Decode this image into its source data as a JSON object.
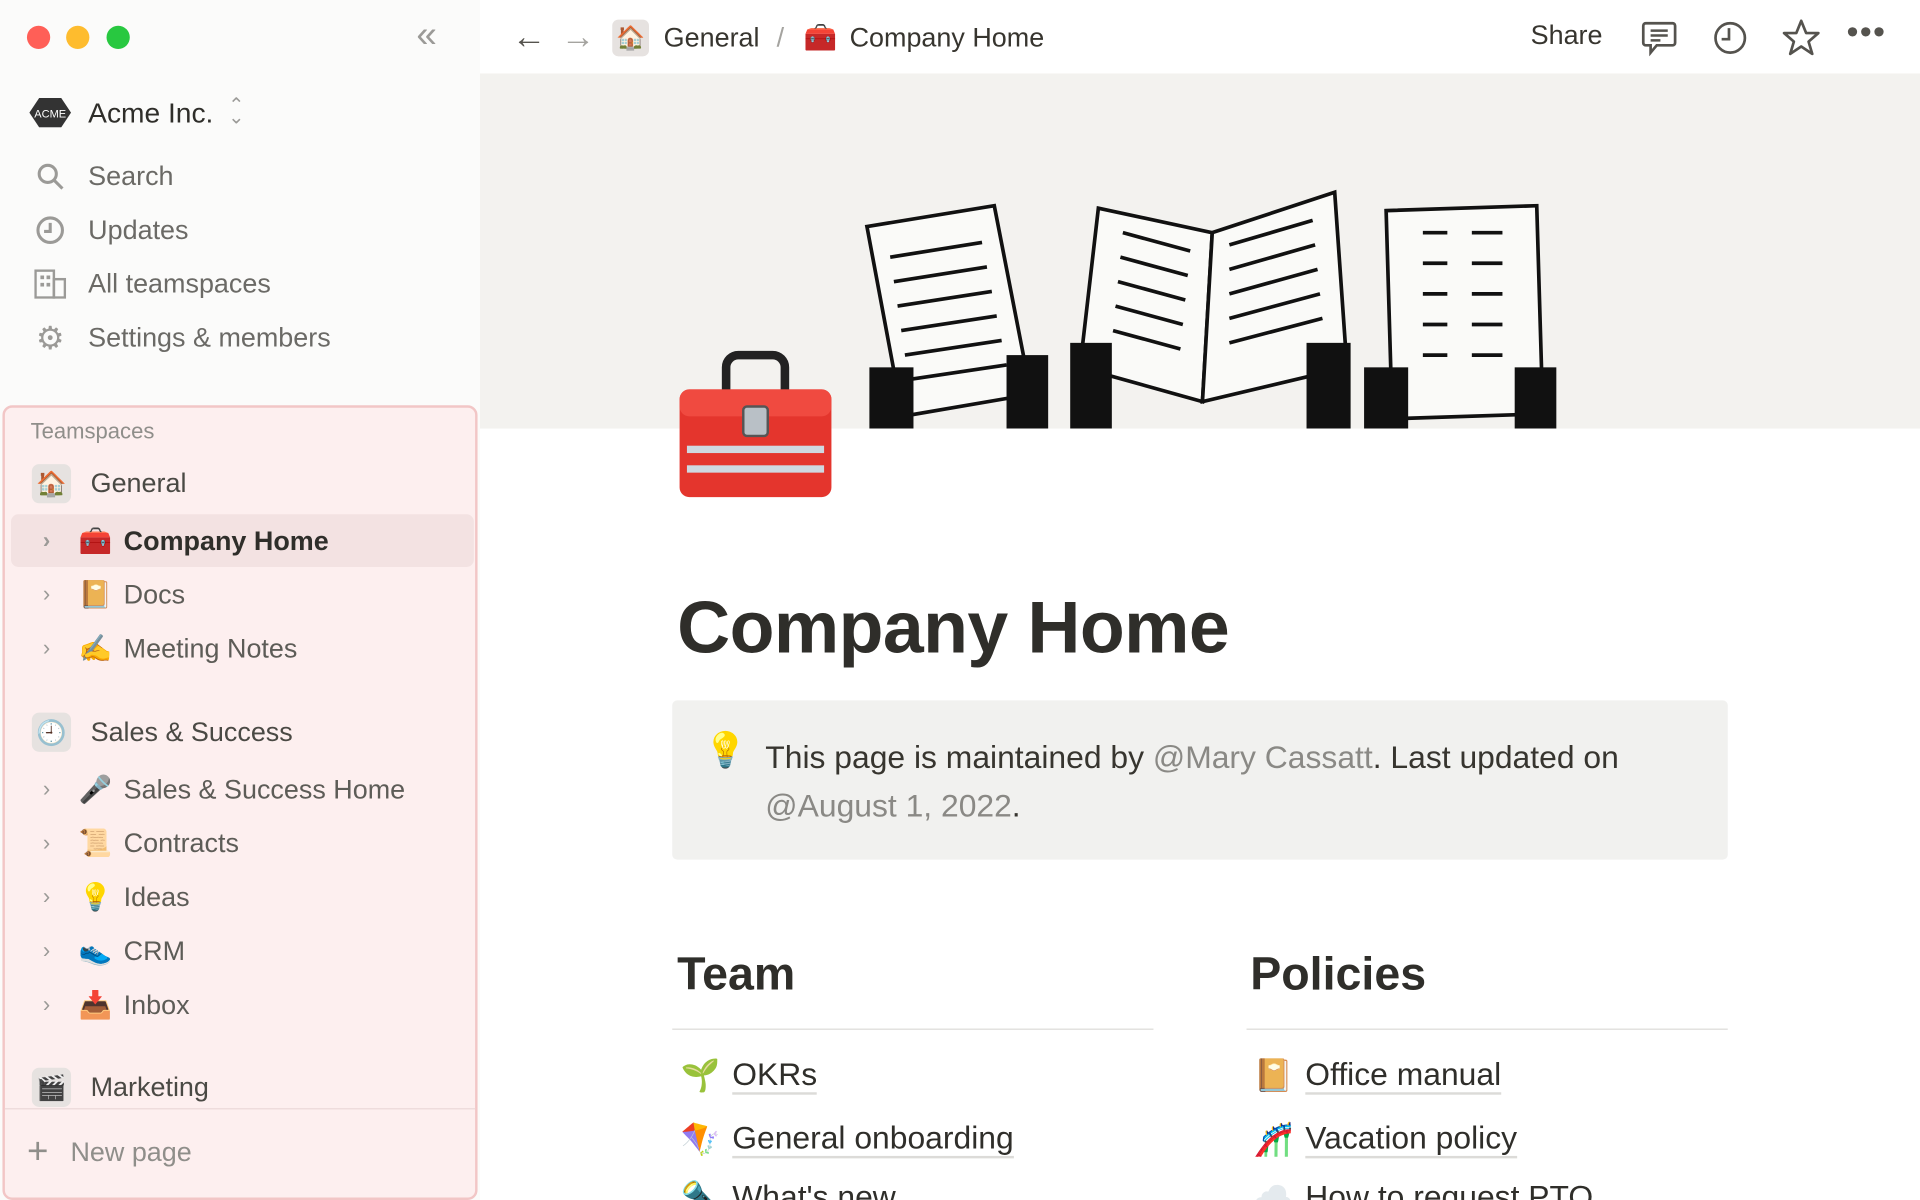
{
  "sidebar": {
    "workspace": {
      "name": "Acme Inc.",
      "logo_text": "ACME"
    },
    "menu": [
      {
        "label": "Search",
        "icon": "search-icon"
      },
      {
        "label": "Updates",
        "icon": "clock-icon"
      },
      {
        "label": "All teamspaces",
        "icon": "building-icon"
      },
      {
        "label": "Settings & members",
        "icon": "gear-icon"
      }
    ],
    "teamspaces_label": "Teamspaces",
    "teamspaces": [
      {
        "name": "General",
        "icon": "🏠",
        "pages": [
          {
            "label": "Company Home",
            "icon": "🧰",
            "active": true
          },
          {
            "label": "Docs",
            "icon": "📔"
          },
          {
            "label": "Meeting Notes",
            "icon": "✍️"
          }
        ]
      },
      {
        "name": "Sales & Success",
        "icon": "🕘",
        "pages": [
          {
            "label": "Sales & Success Home",
            "icon": "🎤"
          },
          {
            "label": "Contracts",
            "icon": "📜"
          },
          {
            "label": "Ideas",
            "icon": "💡"
          },
          {
            "label": "CRM",
            "icon": "👟"
          },
          {
            "label": "Inbox",
            "icon": "📥"
          }
        ]
      },
      {
        "name": "Marketing",
        "icon": "🎬",
        "pages": []
      }
    ],
    "new_page": "New page",
    "highlight_color": "#f2c6c6"
  },
  "topbar": {
    "breadcrumb": [
      {
        "label": "General",
        "icon": "🏠"
      },
      {
        "label": "Company Home",
        "icon": "🧰"
      }
    ],
    "separator": "/",
    "share": "Share"
  },
  "page": {
    "icon": "🧰",
    "title": "Company Home",
    "callout": {
      "icon": "💡",
      "prefix": "This page is maintained by ",
      "mention1": "@Mary Cassatt",
      "middle": ". Last updated on",
      "mention2": "@August 1, 2022",
      "suffix": "."
    },
    "columns": [
      {
        "heading": "Team",
        "links": [
          {
            "label": "OKRs",
            "icon": "🌱"
          },
          {
            "label": "General onboarding",
            "icon": "🪁"
          },
          {
            "label": "What's new",
            "icon": "🔦"
          }
        ]
      },
      {
        "heading": "Policies",
        "links": [
          {
            "label": "Office manual",
            "icon": "📔"
          },
          {
            "label": "Vacation policy",
            "icon": "🎢"
          },
          {
            "label": "How to request PTO",
            "icon": "☁️"
          }
        ]
      }
    ]
  }
}
